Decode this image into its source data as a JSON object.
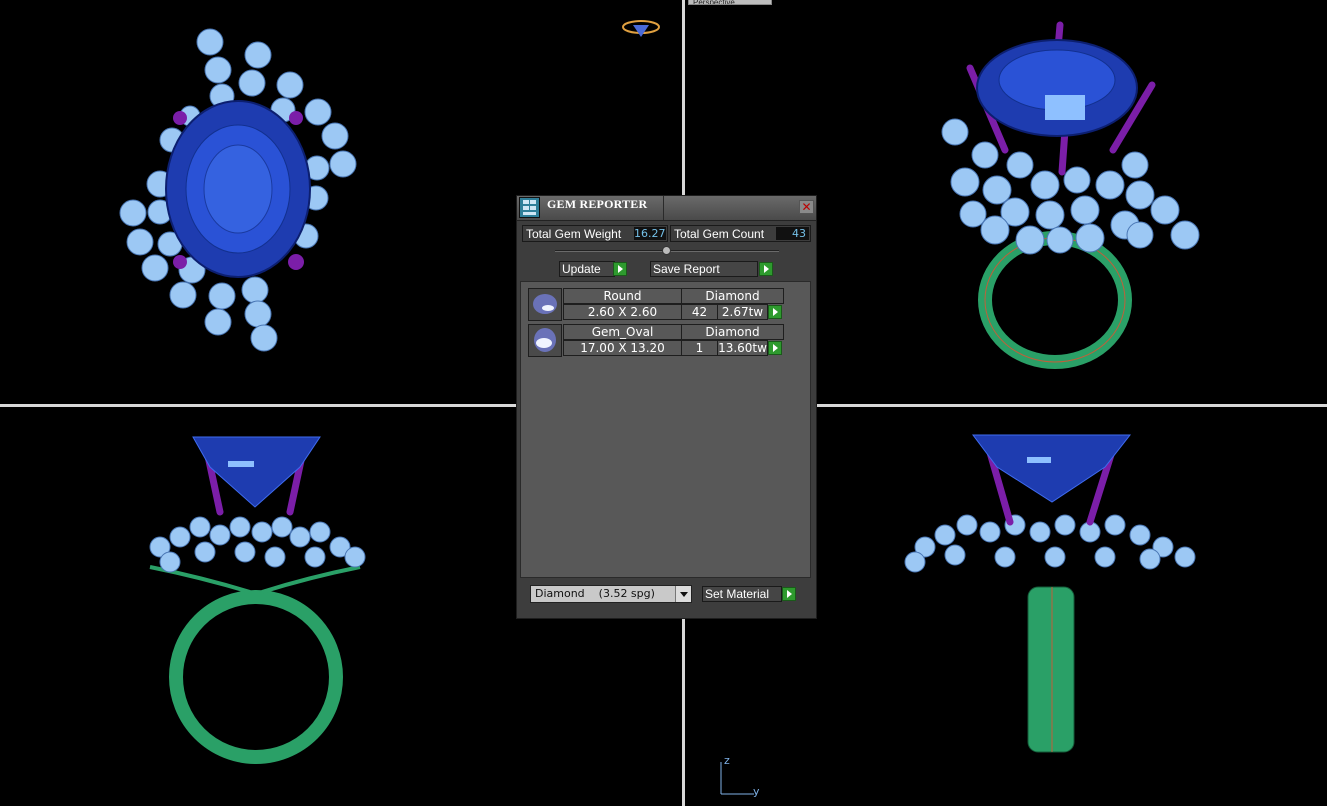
{
  "viewport": {
    "perspective_tab": "Perspective",
    "axis_labels": {
      "z": "z",
      "y": "y"
    }
  },
  "colors": {
    "gem_blue": "#1f3fbf",
    "accent_diamond": "#8fc3f0",
    "prong_purple": "#8a1fb3",
    "metal_green": "#2ca06a",
    "panel_bg": "#3d3d3d"
  },
  "dialog": {
    "title": "GEM REPORTER",
    "total_gem_weight_label": "Total Gem Weight",
    "total_gem_weight": "16.27",
    "total_gem_count_label": "Total Gem Count",
    "total_gem_count": "43",
    "update_label": "Update",
    "save_report_label": "Save Report",
    "gems": [
      {
        "shape": "Round",
        "material": "Diamond",
        "size": "2.60 X 2.60",
        "count": "42",
        "weight": "2.67tw"
      },
      {
        "shape": "Gem_Oval",
        "material": "Diamond",
        "size": "17.00 X 13.20",
        "count": "1",
        "weight": "13.60tw"
      }
    ],
    "material_select": "Diamond    (3.52 spg)",
    "set_material_label": "Set Material"
  }
}
